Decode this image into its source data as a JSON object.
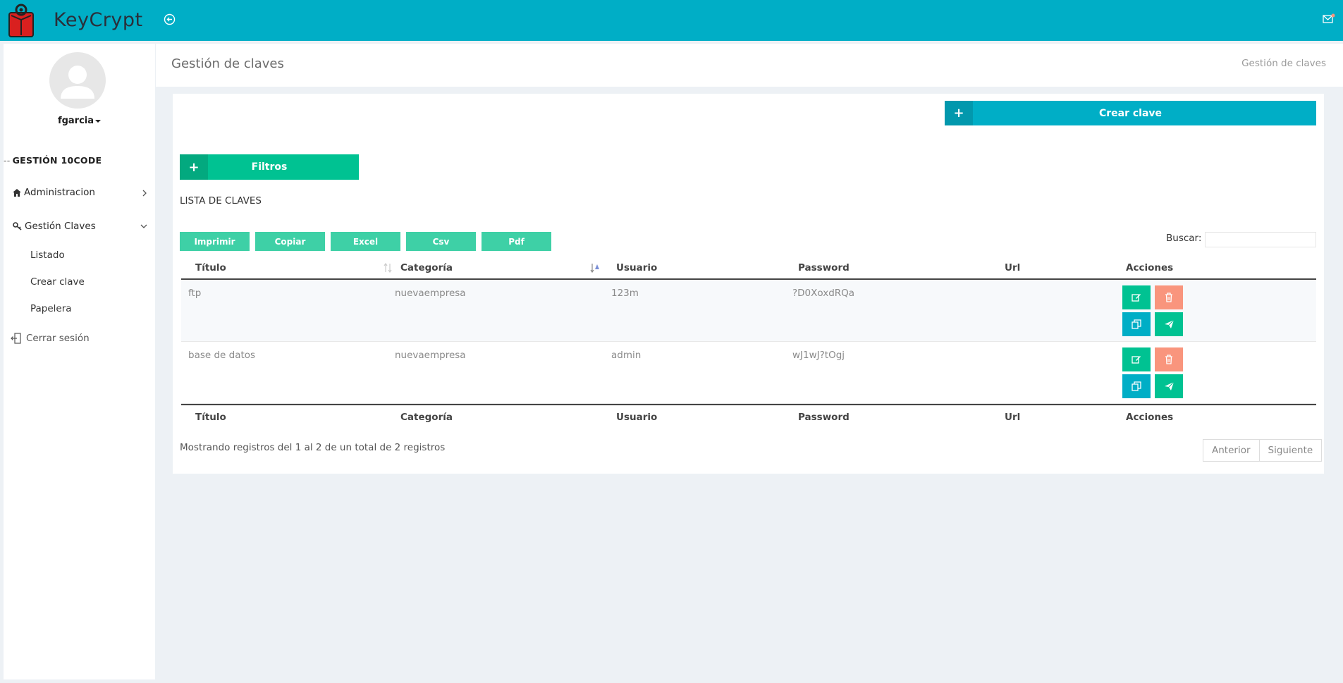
{
  "brand": {
    "name": "KeyCrypt"
  },
  "user": {
    "name": "fgarcia"
  },
  "sidebar": {
    "section": "GESTIÓN 10CODE",
    "items": [
      {
        "label": "Administracion"
      },
      {
        "label": "Gestión Claves"
      }
    ],
    "sub_items": [
      {
        "label": "Listado"
      },
      {
        "label": "Crear clave"
      },
      {
        "label": "Papelera"
      }
    ],
    "logout": "Cerrar sesión"
  },
  "header": {
    "title": "Gestión de claves",
    "breadcrumb": "Gestión de claves"
  },
  "actions": {
    "create": "Crear clave",
    "filters": "Filtros",
    "plus": "+"
  },
  "list": {
    "title": "LISTA DE CLAVES"
  },
  "export": [
    "Imprimir",
    "Copiar",
    "Excel",
    "Csv",
    "Pdf"
  ],
  "search": {
    "label": "Buscar:",
    "value": ""
  },
  "table": {
    "columns": [
      "Título",
      "Categoría",
      "Usuario",
      "Password",
      "Url",
      "Acciones"
    ],
    "rows": [
      {
        "titulo": "ftp",
        "categoria": "nuevaempresa",
        "usuario": "123m",
        "password": "?D0XoxdRQa",
        "url": ""
      },
      {
        "titulo": "base de datos",
        "categoria": "nuevaempresa",
        "usuario": "admin",
        "password": "wJ1wJ?tOgj",
        "url": ""
      }
    ]
  },
  "footer": {
    "info": "Mostrando registros del 1 al 2 de un total de 2 registros",
    "prev": "Anterior",
    "next": "Siguiente"
  },
  "colors": {
    "primary": "#00aec6",
    "success": "#00c292",
    "danger": "#f9957d",
    "background": "#edf1f5"
  }
}
